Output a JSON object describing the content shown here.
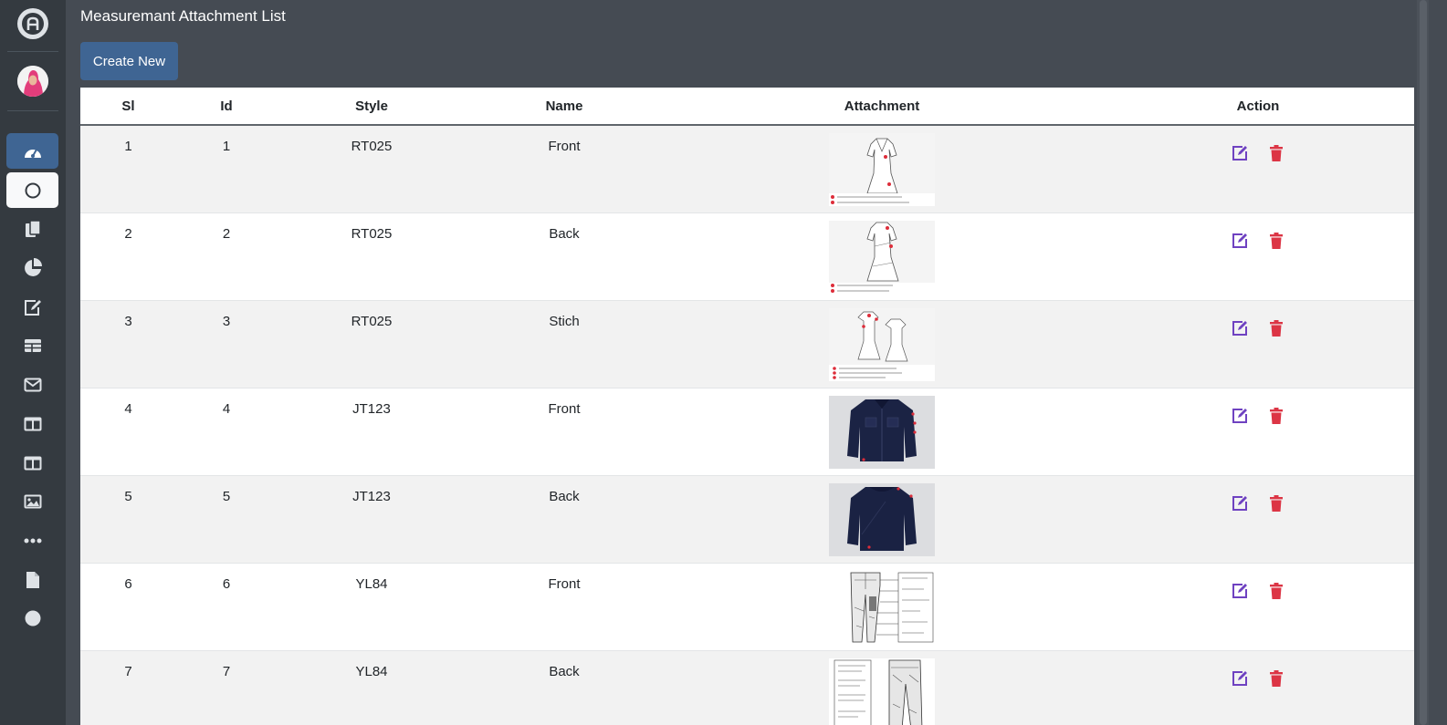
{
  "page": {
    "title": "Measuremant Attachment List",
    "create_button": "Create New"
  },
  "sidebar": {
    "items": [
      {
        "icon": "dashboard-icon",
        "state": "active-blue"
      },
      {
        "icon": "circle-icon",
        "state": "active-white"
      },
      {
        "icon": "copy-icon",
        "state": ""
      },
      {
        "icon": "pie-chart-icon",
        "state": ""
      },
      {
        "icon": "edit-icon",
        "state": ""
      },
      {
        "icon": "table-icon",
        "state": ""
      },
      {
        "icon": "envelope-icon",
        "state": ""
      },
      {
        "icon": "columns-icon",
        "state": ""
      },
      {
        "icon": "columns-icon",
        "state": ""
      },
      {
        "icon": "image-icon",
        "state": ""
      },
      {
        "icon": "ellipsis-icon",
        "state": ""
      },
      {
        "icon": "file-icon",
        "state": ""
      },
      {
        "icon": "filled-circle-icon",
        "state": ""
      }
    ]
  },
  "table": {
    "headers": [
      "Sl",
      "Id",
      "Style",
      "Name",
      "Attachment",
      "Action"
    ],
    "rows": [
      {
        "sl": "1",
        "id": "1",
        "style": "RT025",
        "name": "Front",
        "thumb": "dress-front"
      },
      {
        "sl": "2",
        "id": "2",
        "style": "RT025",
        "name": "Back",
        "thumb": "dress-back"
      },
      {
        "sl": "3",
        "id": "3",
        "style": "RT025",
        "name": "Stich",
        "thumb": "dress-pair"
      },
      {
        "sl": "4",
        "id": "4",
        "style": "JT123",
        "name": "Front",
        "thumb": "jacket-front"
      },
      {
        "sl": "5",
        "id": "5",
        "style": "JT123",
        "name": "Back",
        "thumb": "jacket-back"
      },
      {
        "sl": "6",
        "id": "6",
        "style": "YL84",
        "name": "Front",
        "thumb": "jeans-front"
      },
      {
        "sl": "7",
        "id": "7",
        "style": "YL84",
        "name": "Back",
        "thumb": "jeans-back"
      }
    ]
  },
  "colors": {
    "sidebar_bg": "#343a40",
    "content_bg": "#454b53",
    "primary": "#3f6593",
    "edit_icon": "#6f42c1",
    "delete_icon": "#dc3545"
  }
}
